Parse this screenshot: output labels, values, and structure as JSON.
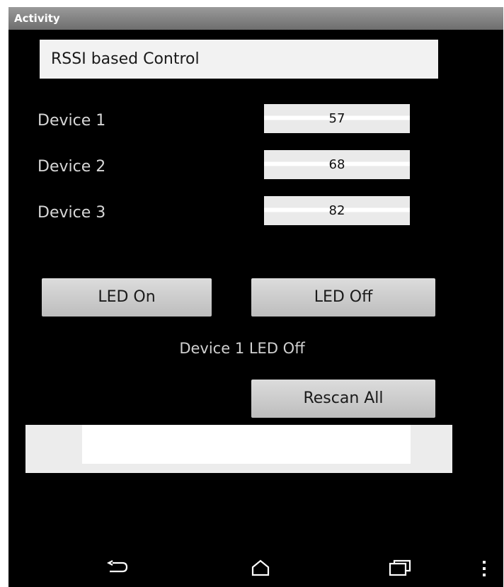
{
  "titlebar": {
    "title": "Activity"
  },
  "header": {
    "text": "RSSI based Control"
  },
  "devices": [
    {
      "label": "Device 1",
      "rssi": "57"
    },
    {
      "label": "Device 2",
      "rssi": "68"
    },
    {
      "label": "Device 3",
      "rssi": "82"
    }
  ],
  "buttons": {
    "led_on": "LED On",
    "led_off": "LED Off",
    "rescan": "Rescan All"
  },
  "status": {
    "text": "Device 1 LED Off"
  },
  "log": {
    "text": ""
  },
  "navbar": {
    "back_icon": "back-icon",
    "home_icon": "home-icon",
    "recents_icon": "recent-apps-icon",
    "menu_icon": "overflow-menu-icon"
  },
  "colors": {
    "background": "#000000",
    "titlebar": "#8a8a8a",
    "button": "#cfcfcf",
    "label": "#d7d7d7"
  }
}
